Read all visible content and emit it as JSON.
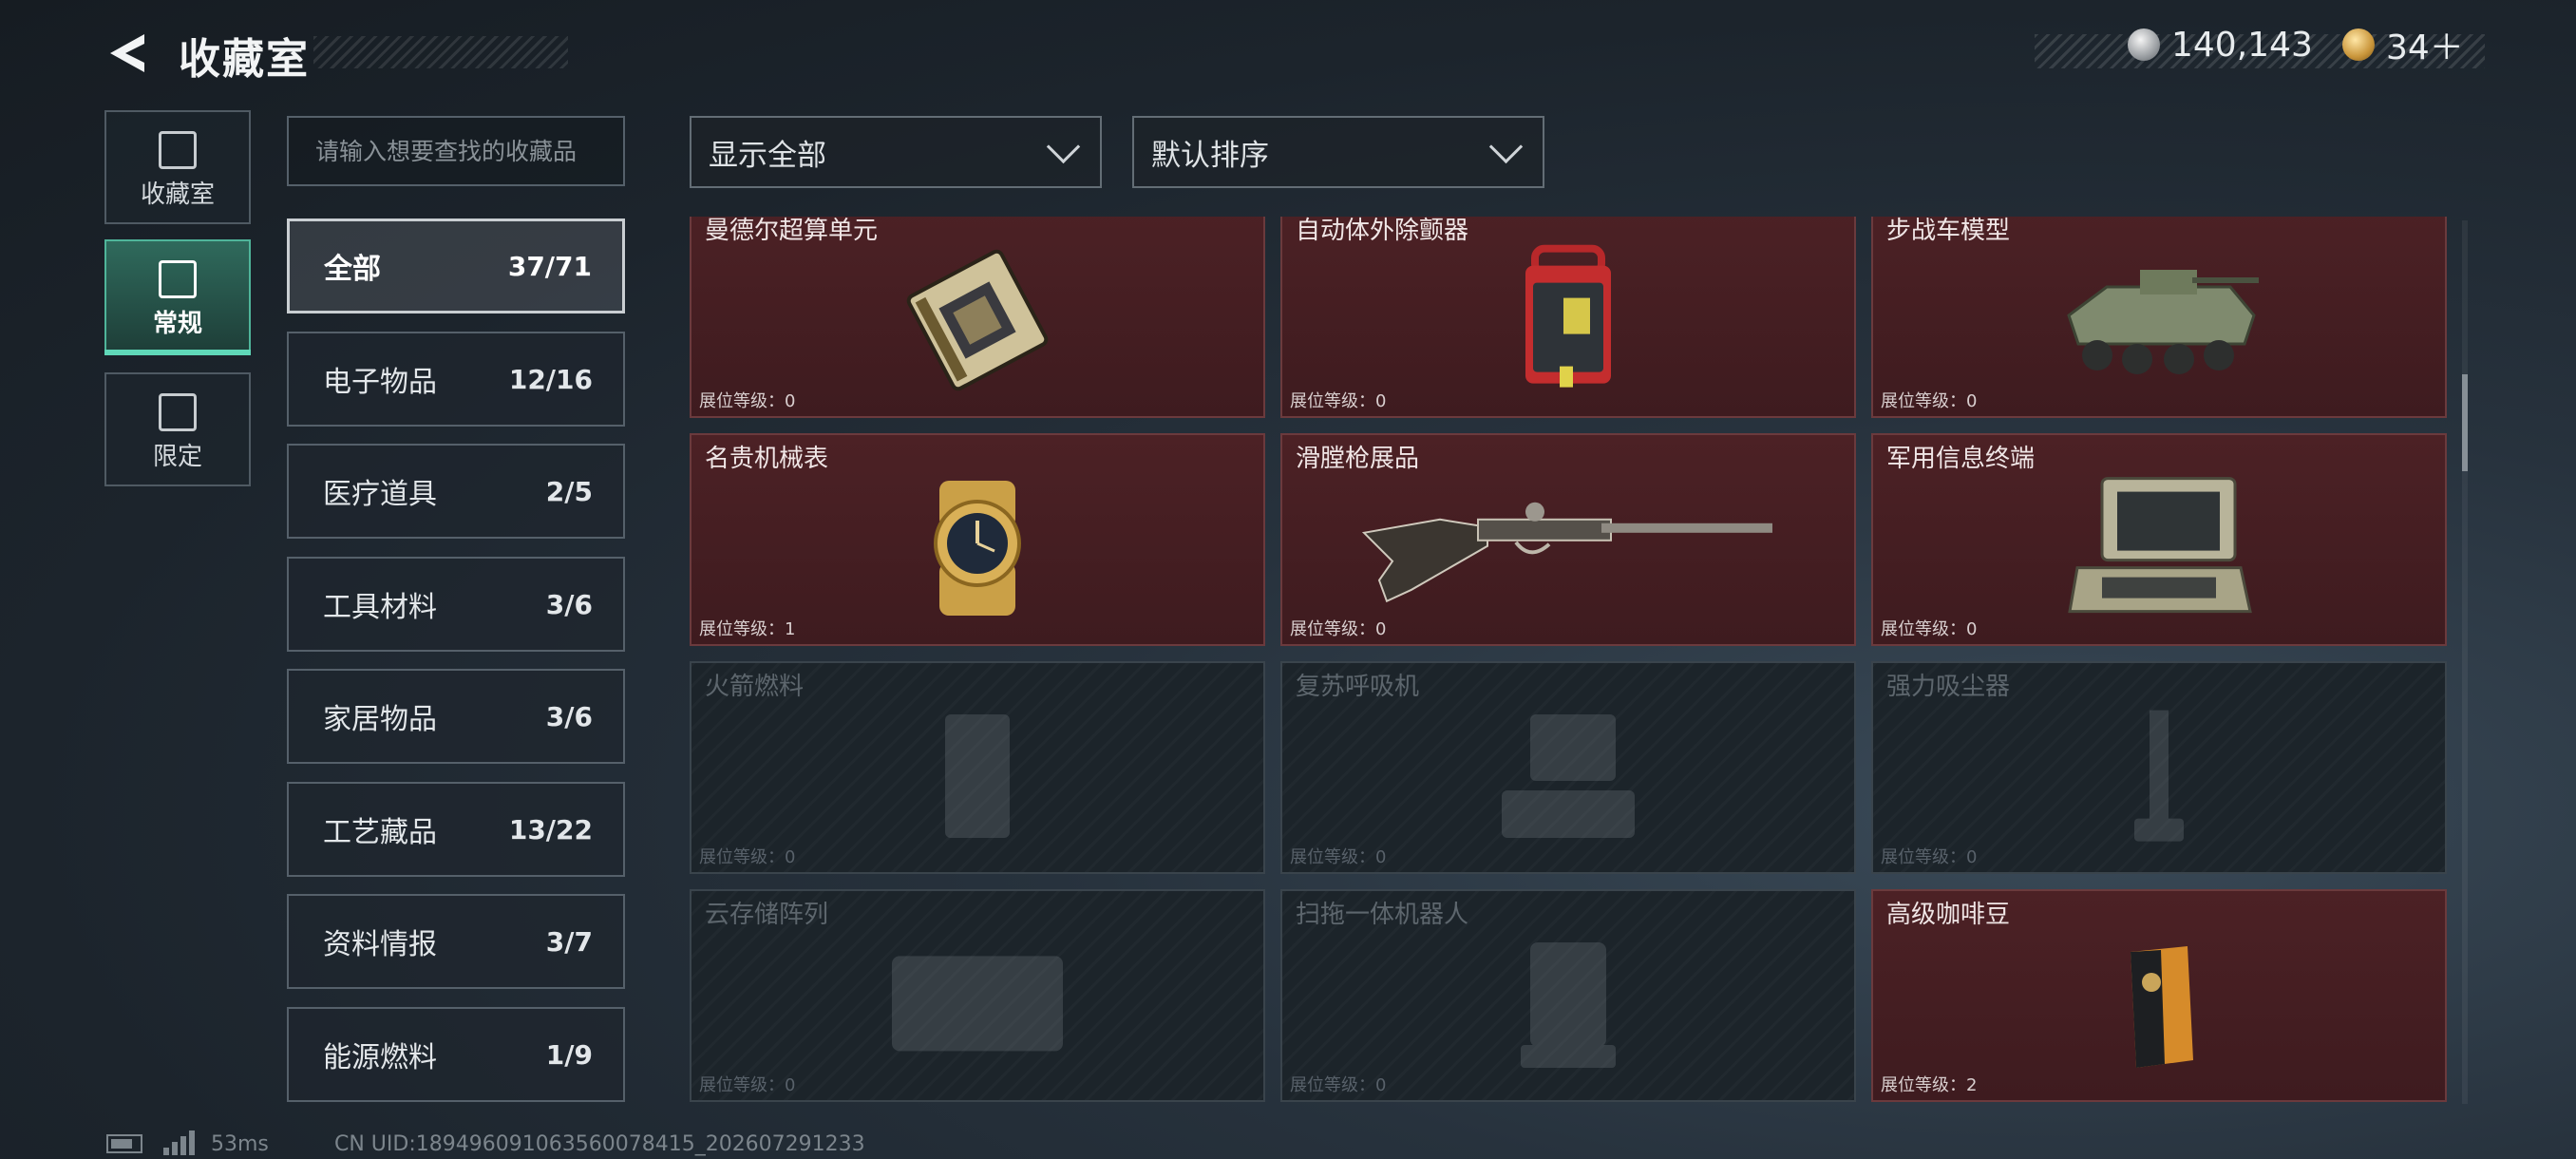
{
  "header": {
    "title": "收藏室",
    "currency_silver": "140,143",
    "currency_gold": "34＋"
  },
  "side_tabs": [
    {
      "label": "收藏室",
      "icon": "collection-room-icon"
    },
    {
      "label": "常规",
      "icon": "regular-icon",
      "active": true
    },
    {
      "label": "限定",
      "icon": "limited-icon"
    }
  ],
  "search": {
    "placeholder": "请输入想要查找的收藏品"
  },
  "categories": [
    {
      "name": "全部",
      "count": "37/71",
      "active": true
    },
    {
      "name": "电子物品",
      "count": "12/16"
    },
    {
      "name": "医疗道具",
      "count": "2/5"
    },
    {
      "name": "工具材料",
      "count": "3/6"
    },
    {
      "name": "家居物品",
      "count": "3/6"
    },
    {
      "name": "工艺藏品",
      "count": "13/22"
    },
    {
      "name": "资料情报",
      "count": "3/7"
    },
    {
      "name": "能源燃料",
      "count": "1/9"
    }
  ],
  "filters": {
    "display": "显示全部",
    "sort": "默认排序"
  },
  "items": [
    {
      "name": "曼德尔超算单元",
      "level": "展位等级：0",
      "icon": "supercomputer-unit-icon",
      "owned": true
    },
    {
      "name": "自动体外除颤器",
      "level": "展位等级：0",
      "icon": "defibrillator-icon",
      "owned": true
    },
    {
      "name": "步战车模型",
      "level": "展位等级：0",
      "icon": "ifv-model-icon",
      "owned": true
    },
    {
      "name": "名贵机械表",
      "level": "展位等级：1",
      "icon": "watch-icon",
      "owned": true
    },
    {
      "name": "滑膛枪展品",
      "level": "展位等级：0",
      "icon": "musket-icon",
      "owned": true
    },
    {
      "name": "军用信息终端",
      "level": "展位等级：0",
      "icon": "military-terminal-icon",
      "owned": true
    },
    {
      "name": "火箭燃料",
      "level": "展位等级：0",
      "icon": "rocket-fuel-icon",
      "owned": false
    },
    {
      "name": "复苏呼吸机",
      "level": "展位等级：0",
      "icon": "ventilator-icon",
      "owned": false
    },
    {
      "name": "强力吸尘器",
      "level": "展位等级：0",
      "icon": "vacuum-icon",
      "owned": false
    },
    {
      "name": "云存储阵列",
      "level": "展位等级：0",
      "icon": "storage-array-icon",
      "owned": false
    },
    {
      "name": "扫拖一体机器人",
      "level": "展位等级：0",
      "icon": "mop-robot-icon",
      "owned": false
    },
    {
      "name": "高级咖啡豆",
      "level": "展位等级：2",
      "icon": "coffee-beans-icon",
      "owned": true
    }
  ],
  "status_bar": {
    "latency": "53ms",
    "uid": "CN UID:18949609106356007841​5_202607291233"
  }
}
